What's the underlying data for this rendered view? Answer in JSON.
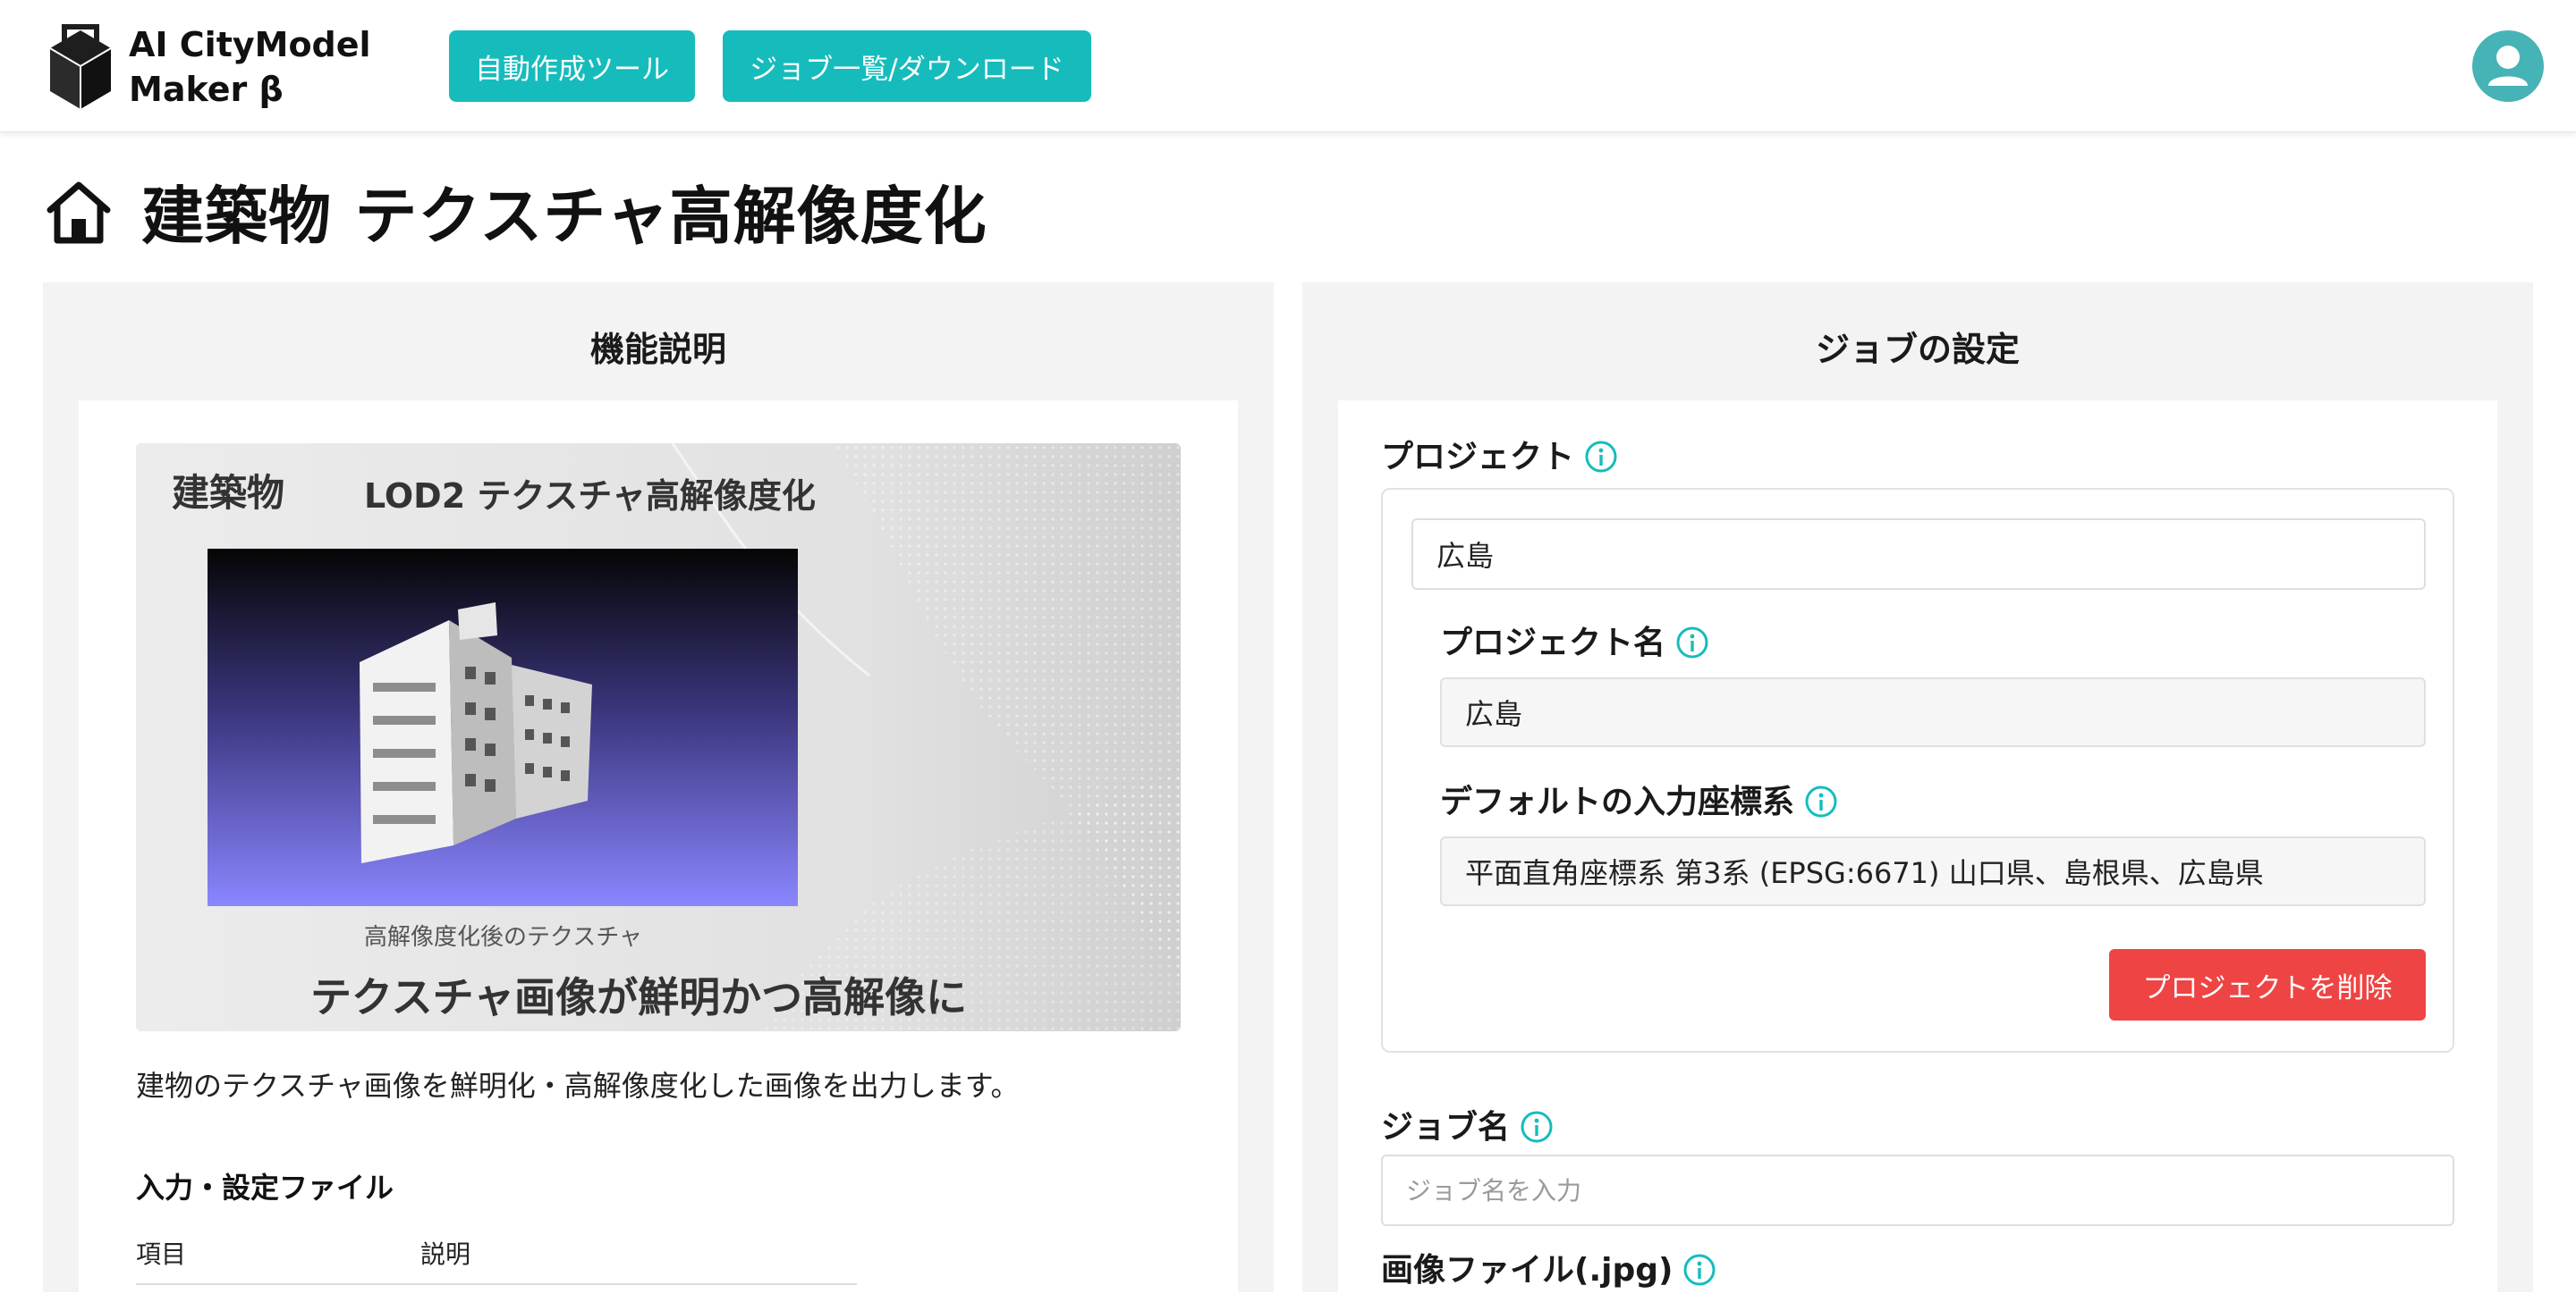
{
  "app": {
    "title_line1": "AI CityModel",
    "title_line2": "Maker β"
  },
  "nav": {
    "auto_tool": "自動作成ツール",
    "jobs_download": "ジョブ一覧/ダウンロード"
  },
  "page": {
    "title": "建築物 テクスチャ高解像度化"
  },
  "left_panel": {
    "heading": "機能説明",
    "image": {
      "category": "建築物",
      "title": "LOD2 テクスチャ高解像度化",
      "caption": "高解像度化後のテクスチャ",
      "tagline": "テクスチャ画像が鮮明かつ高解像に"
    },
    "description": "建物のテクスチャ画像を鮮明化・高解像度化した画像を出力します。",
    "files_heading": "入力・設定ファイル",
    "table_headers": [
      "項目",
      "説明"
    ]
  },
  "right_panel": {
    "heading": "ジョブの設定",
    "project_label": "プロジェクト",
    "project_selected": "広島",
    "project_name_label": "プロジェクト名",
    "project_name_value": "広島",
    "crs_label": "デフォルトの入力座標系",
    "crs_value": "平面直角座標系 第3系 (EPSG:6671) 山口県、島根県、広島県",
    "delete_button": "プロジェクトを削除",
    "job_name_label": "ジョブ名",
    "job_name_placeholder": "ジョブ名を入力",
    "image_file_label": "画像ファイル(.jpg)"
  },
  "colors": {
    "accent": "#16bcbc",
    "danger": "#ef4444",
    "avatar": "#46b3b6",
    "panel_bg": "#f3f3f3"
  },
  "icons": [
    "logo-cube-icon",
    "home-icon",
    "info-icon",
    "user-avatar-icon"
  ]
}
